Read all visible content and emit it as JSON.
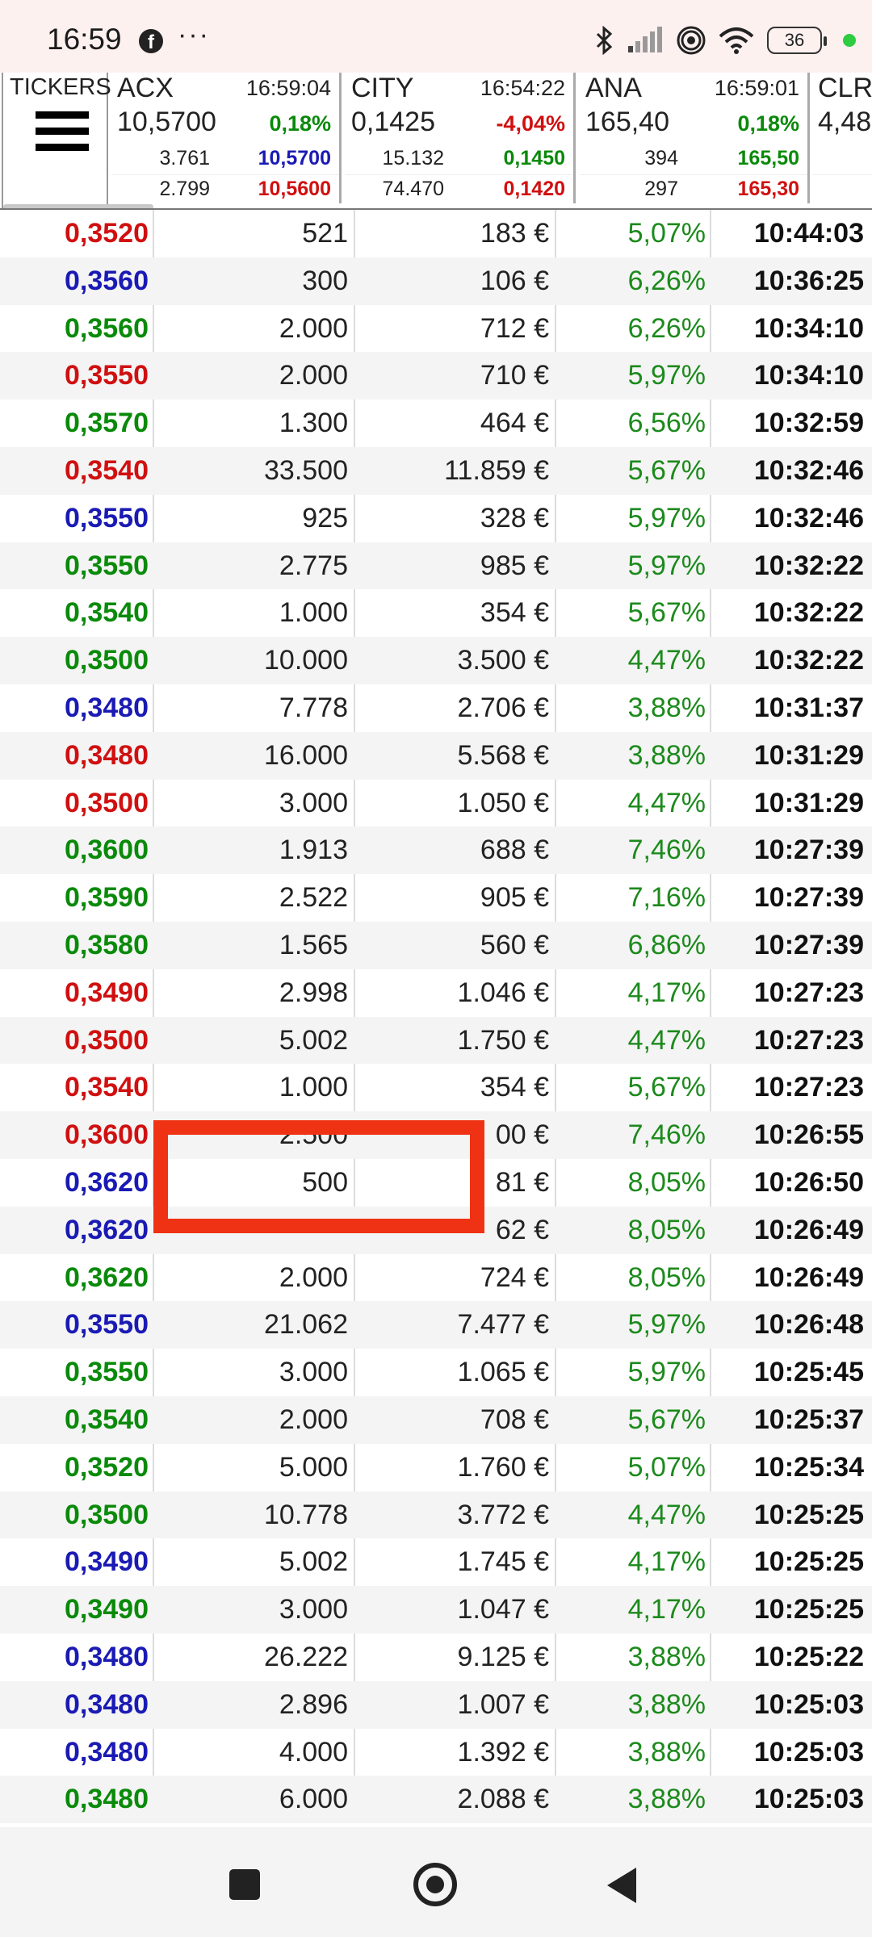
{
  "status_bar": {
    "time": "16:59",
    "app_icon": "facebook-icon",
    "more": "···",
    "battery": "36",
    "icons": [
      "bluetooth-icon",
      "signal-icon",
      "hotspot-icon",
      "wifi-icon"
    ]
  },
  "ticker": {
    "label": "TICKERS",
    "cards": [
      {
        "name": "ACX",
        "time": "16:59:04",
        "price": "10,5700",
        "change": "0,18%",
        "change_color": "#0a8a0a",
        "bid_qty": "3.761",
        "bid": "10,5700",
        "bid_color": "#1a1ab4",
        "ask_qty": "2.799",
        "ask": "10,5600",
        "ask_color": "#d01010"
      },
      {
        "name": "CITY",
        "time": "16:54:22",
        "price": "0,1425",
        "change": "-4,04%",
        "change_color": "#d01010",
        "bid_qty": "15.132",
        "bid": "0,1450",
        "bid_color": "#0a8a0a",
        "ask_qty": "74.470",
        "ask": "0,1420",
        "ask_color": "#d01010"
      },
      {
        "name": "ANA",
        "time": "16:59:01",
        "price": "165,40",
        "change": "0,18%",
        "change_color": "#0a8a0a",
        "bid_qty": "394",
        "bid": "165,50",
        "bid_color": "#0a8a0a",
        "ask_qty": "297",
        "ask": "165,30",
        "ask_color": "#d01010"
      },
      {
        "name": "CLR",
        "time": "",
        "price": "4,48",
        "change": "",
        "change_color": "#0a8a0a",
        "bid_qty": "",
        "bid": "",
        "bid_color": "#0a8a0a",
        "ask_qty": "",
        "ask": "",
        "ask_color": "#d01010"
      }
    ]
  },
  "colors": {
    "green": "#0a8a0a",
    "red": "#d01010",
    "blue": "#1a1ab4",
    "highlight": "#f03214"
  },
  "trades": [
    {
      "price": "0,3520",
      "color": "red",
      "qty": "521",
      "amount": "183 €",
      "pct": "5,07%",
      "time": "10:44:03"
    },
    {
      "price": "0,3560",
      "color": "blue",
      "qty": "300",
      "amount": "106 €",
      "pct": "6,26%",
      "time": "10:36:25"
    },
    {
      "price": "0,3560",
      "color": "green",
      "qty": "2.000",
      "amount": "712 €",
      "pct": "6,26%",
      "time": "10:34:10"
    },
    {
      "price": "0,3550",
      "color": "red",
      "qty": "2.000",
      "amount": "710 €",
      "pct": "5,97%",
      "time": "10:34:10"
    },
    {
      "price": "0,3570",
      "color": "green",
      "qty": "1.300",
      "amount": "464 €",
      "pct": "6,56%",
      "time": "10:32:59"
    },
    {
      "price": "0,3540",
      "color": "red",
      "qty": "33.500",
      "amount": "11.859 €",
      "pct": "5,67%",
      "time": "10:32:46"
    },
    {
      "price": "0,3550",
      "color": "blue",
      "qty": "925",
      "amount": "328 €",
      "pct": "5,97%",
      "time": "10:32:46"
    },
    {
      "price": "0,3550",
      "color": "green",
      "qty": "2.775",
      "amount": "985 €",
      "pct": "5,97%",
      "time": "10:32:22"
    },
    {
      "price": "0,3540",
      "color": "green",
      "qty": "1.000",
      "amount": "354 €",
      "pct": "5,67%",
      "time": "10:32:22"
    },
    {
      "price": "0,3500",
      "color": "green",
      "qty": "10.000",
      "amount": "3.500 €",
      "pct": "4,47%",
      "time": "10:32:22"
    },
    {
      "price": "0,3480",
      "color": "blue",
      "qty": "7.778",
      "amount": "2.706 €",
      "pct": "3,88%",
      "time": "10:31:37"
    },
    {
      "price": "0,3480",
      "color": "red",
      "qty": "16.000",
      "amount": "5.568 €",
      "pct": "3,88%",
      "time": "10:31:29"
    },
    {
      "price": "0,3500",
      "color": "red",
      "qty": "3.000",
      "amount": "1.050 €",
      "pct": "4,47%",
      "time": "10:31:29"
    },
    {
      "price": "0,3600",
      "color": "green",
      "qty": "1.913",
      "amount": "688 €",
      "pct": "7,46%",
      "time": "10:27:39"
    },
    {
      "price": "0,3590",
      "color": "green",
      "qty": "2.522",
      "amount": "905 €",
      "pct": "7,16%",
      "time": "10:27:39"
    },
    {
      "price": "0,3580",
      "color": "green",
      "qty": "1.565",
      "amount": "560 €",
      "pct": "6,86%",
      "time": "10:27:39"
    },
    {
      "price": "0,3490",
      "color": "red",
      "qty": "2.998",
      "amount": "1.046 €",
      "pct": "4,17%",
      "time": "10:27:23"
    },
    {
      "price": "0,3500",
      "color": "red",
      "qty": "5.002",
      "amount": "1.750 €",
      "pct": "4,47%",
      "time": "10:27:23"
    },
    {
      "price": "0,3540",
      "color": "red",
      "qty": "1.000",
      "amount": "354 €",
      "pct": "5,67%",
      "time": "10:27:23"
    },
    {
      "price": "0,3600",
      "color": "red",
      "qty": "2.500",
      "amount": "00 €",
      "pct": "7,46%",
      "time": "10:26:55"
    },
    {
      "price": "0,3620",
      "color": "blue",
      "qty": "500",
      "amount": "81 €",
      "pct": "8,05%",
      "time": "10:26:50"
    },
    {
      "price": "0,3620",
      "color": "blue",
      "qty": "",
      "amount": "62 €",
      "pct": "8,05%",
      "time": "10:26:49"
    },
    {
      "price": "0,3620",
      "color": "green",
      "qty": "2.000",
      "amount": "724 €",
      "pct": "8,05%",
      "time": "10:26:49"
    },
    {
      "price": "0,3550",
      "color": "blue",
      "qty": "21.062",
      "amount": "7.477 €",
      "pct": "5,97%",
      "time": "10:26:48"
    },
    {
      "price": "0,3550",
      "color": "green",
      "qty": "3.000",
      "amount": "1.065 €",
      "pct": "5,97%",
      "time": "10:25:45"
    },
    {
      "price": "0,3540",
      "color": "green",
      "qty": "2.000",
      "amount": "708 €",
      "pct": "5,67%",
      "time": "10:25:37"
    },
    {
      "price": "0,3520",
      "color": "green",
      "qty": "5.000",
      "amount": "1.760 €",
      "pct": "5,07%",
      "time": "10:25:34"
    },
    {
      "price": "0,3500",
      "color": "green",
      "qty": "10.778",
      "amount": "3.772 €",
      "pct": "4,47%",
      "time": "10:25:25"
    },
    {
      "price": "0,3490",
      "color": "blue",
      "qty": "5.002",
      "amount": "1.745 €",
      "pct": "4,17%",
      "time": "10:25:25"
    },
    {
      "price": "0,3490",
      "color": "green",
      "qty": "3.000",
      "amount": "1.047 €",
      "pct": "4,17%",
      "time": "10:25:25"
    },
    {
      "price": "0,3480",
      "color": "blue",
      "qty": "26.222",
      "amount": "9.125 €",
      "pct": "3,88%",
      "time": "10:25:22"
    },
    {
      "price": "0,3480",
      "color": "blue",
      "qty": "2.896",
      "amount": "1.007 €",
      "pct": "3,88%",
      "time": "10:25:03"
    },
    {
      "price": "0,3480",
      "color": "blue",
      "qty": "4.000",
      "amount": "1.392 €",
      "pct": "3,88%",
      "time": "10:25:03"
    },
    {
      "price": "0,3480",
      "color": "green",
      "qty": "6.000",
      "amount": "2.088 €",
      "pct": "3,88%",
      "time": "10:25:03"
    }
  ],
  "nav": {
    "recents": "recents-square-icon",
    "home": "home-circle-icon",
    "back": "back-triangle-icon"
  }
}
